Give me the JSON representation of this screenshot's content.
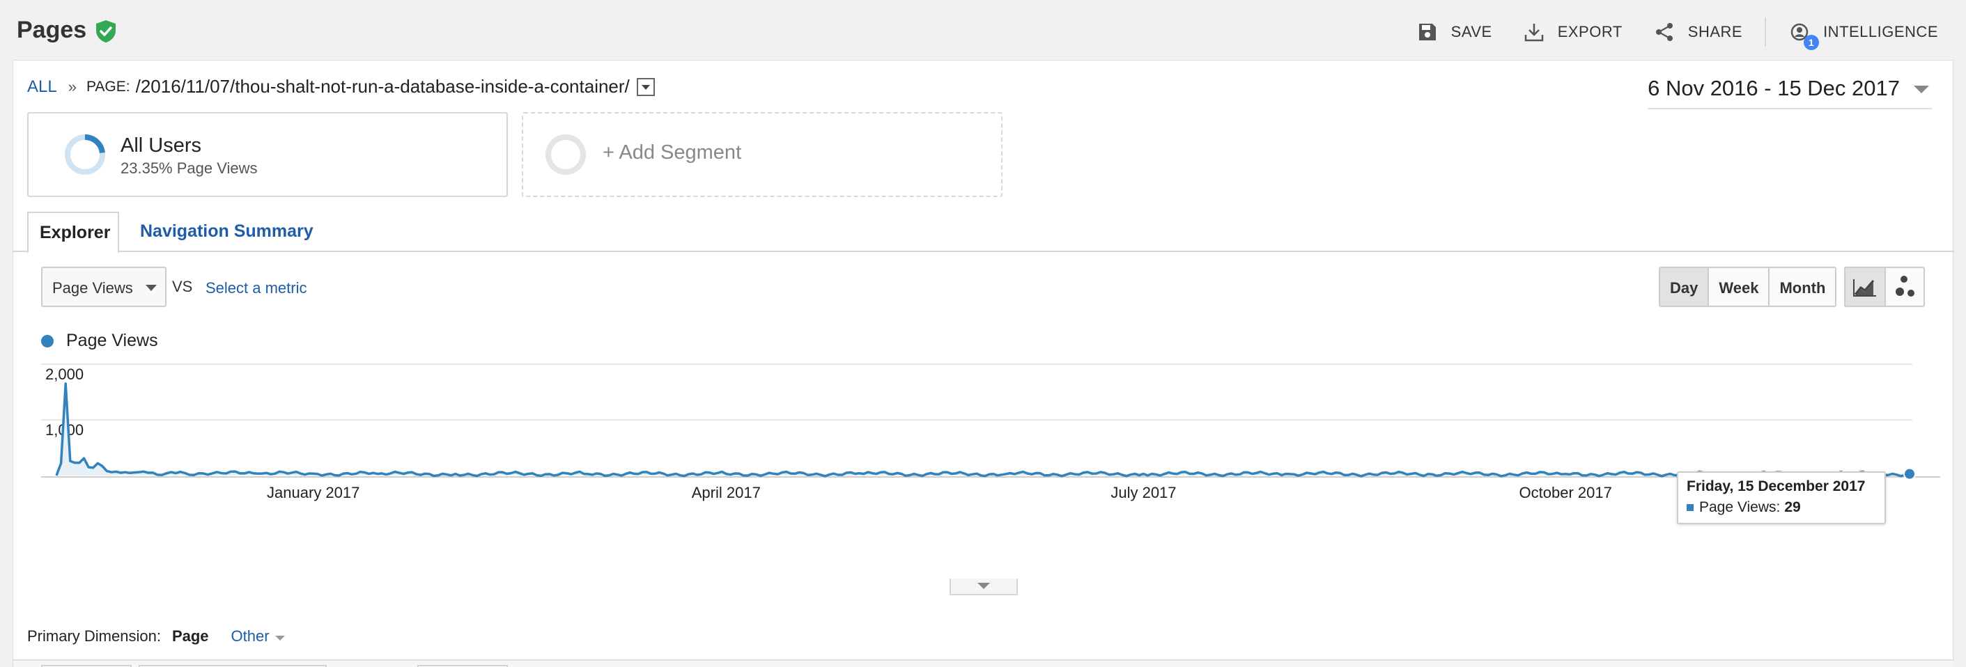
{
  "header": {
    "title": "Pages",
    "actions": {
      "save": "SAVE",
      "export": "EXPORT",
      "share": "SHARE",
      "intelligence": "INTELLIGENCE",
      "intelligence_badge": "1"
    }
  },
  "breadcrumb": {
    "all": "ALL",
    "separator": "»",
    "key": "PAGE:",
    "page": "/2016/11/07/thou-shalt-not-run-a-database-inside-a-container/"
  },
  "date_range": "6 Nov 2016 - 15 Dec 2017",
  "segments": {
    "all_users": {
      "name": "All Users",
      "sub": "23.35% Page Views",
      "share": 0.2335
    },
    "add_segment": "+ Add Segment"
  },
  "tabs": {
    "explorer": "Explorer",
    "navigation_summary": "Navigation Summary"
  },
  "controls": {
    "metric": "Page Views",
    "vs": "VS",
    "select_metric": "Select a metric",
    "granularity": [
      "Day",
      "Week",
      "Month"
    ],
    "active_granularity": "Day"
  },
  "tooltip": {
    "date": "Friday, 15 December 2017",
    "label": "Page Views:",
    "value": "29"
  },
  "primary_dimension": {
    "label": "Primary Dimension:",
    "selected": "Page",
    "other": "Other"
  },
  "colors": {
    "series": "#3182bd",
    "link": "#1e5ca8",
    "verified": "#34a853"
  },
  "chart_data": {
    "type": "area",
    "series": [
      {
        "name": "Page Views",
        "x": [
          "2016-11-06",
          "2016-11-07",
          "2016-11-08",
          "2016-11-09",
          "2016-11-10",
          "2016-11-11",
          "2016-11-12",
          "2016-11-13",
          "2016-11-14",
          "2016-11-15",
          "2016-11-16",
          "2016-11-17",
          "2016-11-18",
          "2016-11-19",
          "2016-11-20",
          "2016-11-21",
          "2016-11-23",
          "2016-11-26",
          "2016-11-30",
          "2016-12-04",
          "2016-12-10",
          "2016-12-20",
          "2017-01-01",
          "2017-01-15",
          "2017-02-01",
          "2017-03-01",
          "2017-04-01",
          "2017-05-01",
          "2017-06-01",
          "2017-07-01",
          "2017-08-01",
          "2017-09-01",
          "2017-10-01",
          "2017-11-01",
          "2017-12-01",
          "2017-12-15"
        ],
        "values": [
          0,
          220,
          1650,
          260,
          230,
          230,
          310,
          150,
          140,
          220,
          170,
          80,
          60,
          70,
          50,
          60,
          55,
          50,
          40,
          45,
          40,
          35,
          35,
          30,
          30,
          30,
          30,
          30,
          28,
          30,
          30,
          28,
          28,
          30,
          32,
          29
        ]
      }
    ],
    "x_tick_labels": [
      "January 2017",
      "April 2017",
      "July 2017",
      "October 2017"
    ],
    "x_tick_dates": [
      "2017-01-01",
      "2017-04-01",
      "2017-07-01",
      "2017-10-01"
    ],
    "y_tick_labels": [
      "2,000",
      "1,000"
    ],
    "y_ticks": [
      2000,
      1000
    ],
    "ylim": [
      0,
      2000
    ],
    "xlim": [
      "2016-11-06",
      "2017-12-15"
    ],
    "grid": true,
    "legend": "top-left",
    "highlight_date": "2017-12-15"
  }
}
